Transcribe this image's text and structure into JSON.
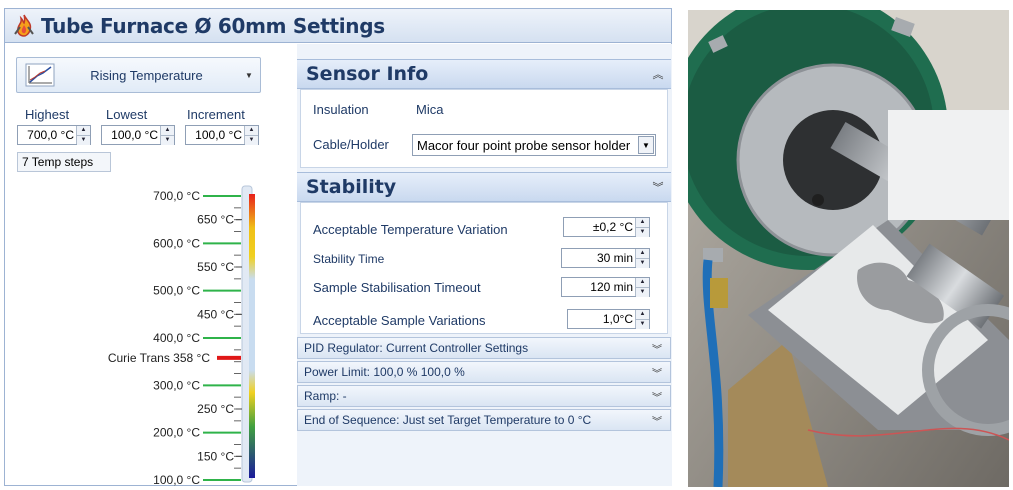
{
  "window": {
    "title": "Tube Furnace Ø 60mm Settings"
  },
  "mode": {
    "label": "Rising Temperature"
  },
  "fields": {
    "highest": {
      "label": "Highest",
      "value": "700,0 °C"
    },
    "lowest": {
      "label": "Lowest",
      "value": "100,0 °C"
    },
    "increment": {
      "label": "Increment",
      "value": "100,0 °C"
    }
  },
  "steps_text": "7 Temp steps",
  "scale": {
    "left_labels": [
      "700,0 °C",
      "600,0 °C",
      "500,0 °C",
      "400,0 °C",
      "300,0 °C",
      "200,0 °C",
      "100,0 °C"
    ],
    "right_labels": [
      "650 °C",
      "550 °C",
      "450 °C",
      "250 °C",
      "150 °C"
    ],
    "curie_label": "Curie Trans 358 °C",
    "gradient_colors": [
      "#e8201b",
      "#f0d020",
      "#c8dcf0",
      "#f0d020",
      "#1a1a9a"
    ]
  },
  "sensor": {
    "title": "Sensor Info",
    "insulation_label": "Insulation",
    "insulation_value": "Mica",
    "cable_label": "Cable/Holder",
    "cable_value": "Macor four point probe sensor holder"
  },
  "stability": {
    "title": "Stability",
    "rows": [
      {
        "label": "Acceptable Temperature Variation",
        "value": "±0,2 °C"
      },
      {
        "label": "Stability Time",
        "value": "30 min"
      },
      {
        "label": "Sample Stabilisation Timeout",
        "value": "120 min"
      },
      {
        "label": "Acceptable Sample Variations",
        "value": "1,0°C"
      }
    ]
  },
  "bars": {
    "pid": "PID Regulator: Current Controller Settings",
    "power": "Power Limit: 100,0 % 100,0 %",
    "ramp": "Ramp: -",
    "end": "End of Sequence: Just set Target Temperature to 0 °C"
  }
}
